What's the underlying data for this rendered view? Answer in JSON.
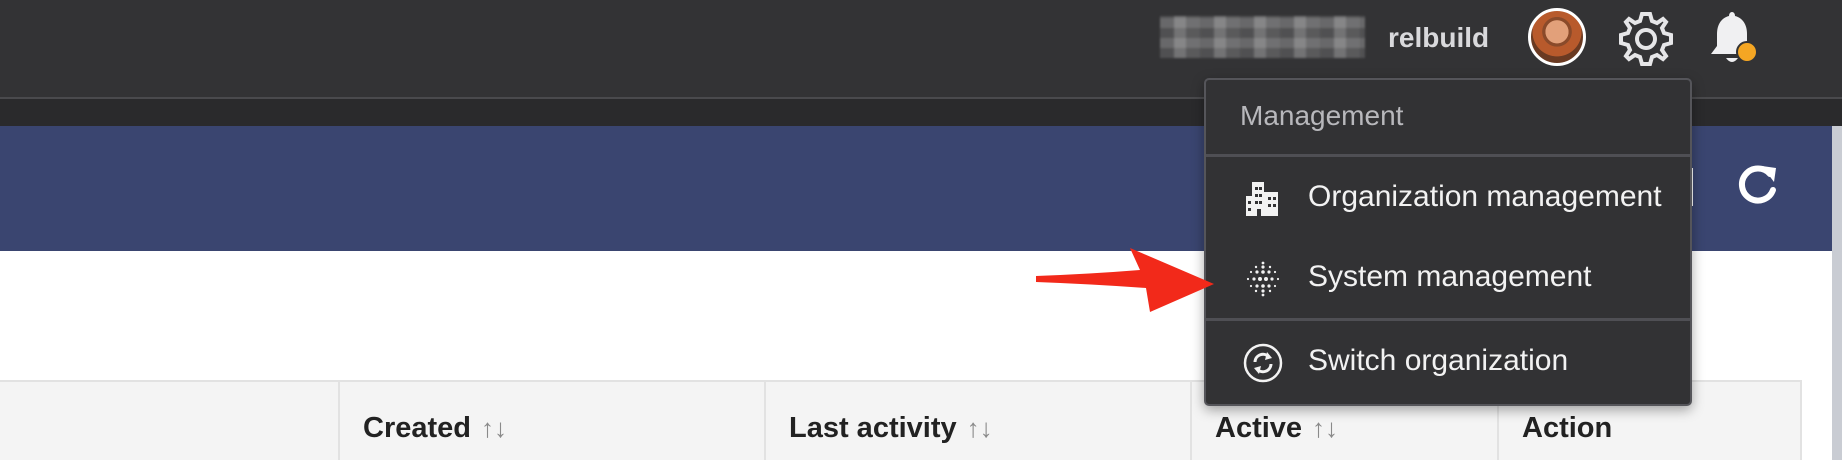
{
  "header": {
    "username": "relbuild",
    "icons": [
      "avatar",
      "gear-icon",
      "bell-icon"
    ],
    "notification_dot_color": "#f5a623"
  },
  "banner": {
    "icons": [
      "refresh-icon"
    ]
  },
  "table": {
    "columns": [
      {
        "label": "Created",
        "sortable": true
      },
      {
        "label": "Last activity",
        "sortable": true
      },
      {
        "label": "Active",
        "sortable": true
      },
      {
        "label": "Action",
        "sortable": false
      }
    ],
    "sort_glyph": "↑↓"
  },
  "menu": {
    "header": "Management",
    "items": [
      {
        "label": "Organization management",
        "icon": "building-icon"
      },
      {
        "label": "System management",
        "icon": "dots-sphere-icon"
      },
      {
        "label": "Switch organization",
        "icon": "switch-icon"
      }
    ]
  },
  "colors": {
    "topbar": "#333335",
    "banner": "#3a4570",
    "menu_bg": "#323234",
    "arrow": "#f2291a"
  }
}
